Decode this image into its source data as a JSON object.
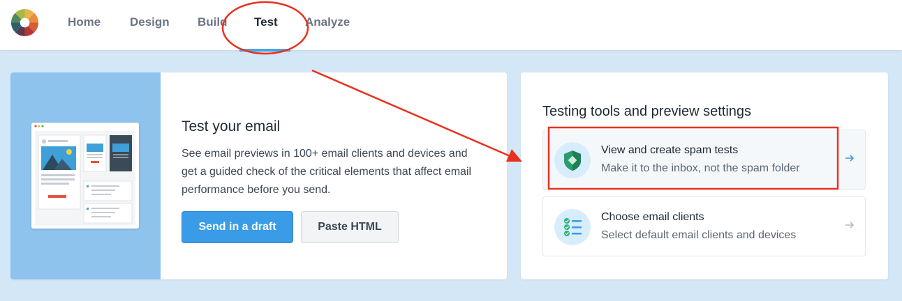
{
  "nav": {
    "items": [
      {
        "label": "Home"
      },
      {
        "label": "Design"
      },
      {
        "label": "Build"
      },
      {
        "label": "Test"
      },
      {
        "label": "Analyze"
      }
    ],
    "active": "Test"
  },
  "test_card": {
    "title": "Test your email",
    "description": "See email previews in 100+ email clients and devices and get a guided check of the critical elements that affect email performance before you send.",
    "primary_button": "Send in a draft",
    "secondary_button": "Paste HTML"
  },
  "tools_card": {
    "title": "Testing tools and preview settings",
    "tools": [
      {
        "title": "View and create spam tests",
        "subtitle": "Make it to the inbox, not the spam folder",
        "icon": "shield-icon"
      },
      {
        "title": "Choose email clients",
        "subtitle": "Select default email clients and devices",
        "icon": "checklist-icon"
      }
    ]
  },
  "colors": {
    "accent": "#3a9be6",
    "annotation": "#e8321e",
    "page_bg": "#d3e7f6"
  }
}
